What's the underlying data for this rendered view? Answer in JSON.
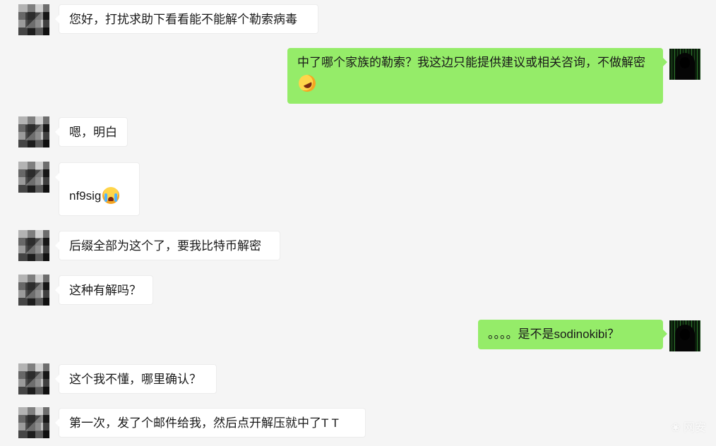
{
  "messages": [
    {
      "side": "in",
      "text": "您好，打扰求助下看看能不能解个勒索病毒"
    },
    {
      "side": "out",
      "text": "中了哪个家族的勒索？我这边只能提供建议或相关咨询，不做解密",
      "emoji": "rolling-on-floor-laughing-emoji"
    },
    {
      "side": "in",
      "text": "嗯，明白"
    },
    {
      "side": "in",
      "text": "nf9sig",
      "emoji": "crying-face-emoji"
    },
    {
      "side": "in",
      "text": "后缀全部为这个了，要我比特币解密"
    },
    {
      "side": "in",
      "text": "这种有解吗？"
    },
    {
      "side": "out",
      "text": "。。。。是不是sodinokibi？"
    },
    {
      "side": "in",
      "text": "这个我不懂，哪里确认？"
    },
    {
      "side": "in",
      "text": "第一次，发了个邮件给我，然后点开解压就中了T T"
    }
  ],
  "watermark": "❀ 网安"
}
